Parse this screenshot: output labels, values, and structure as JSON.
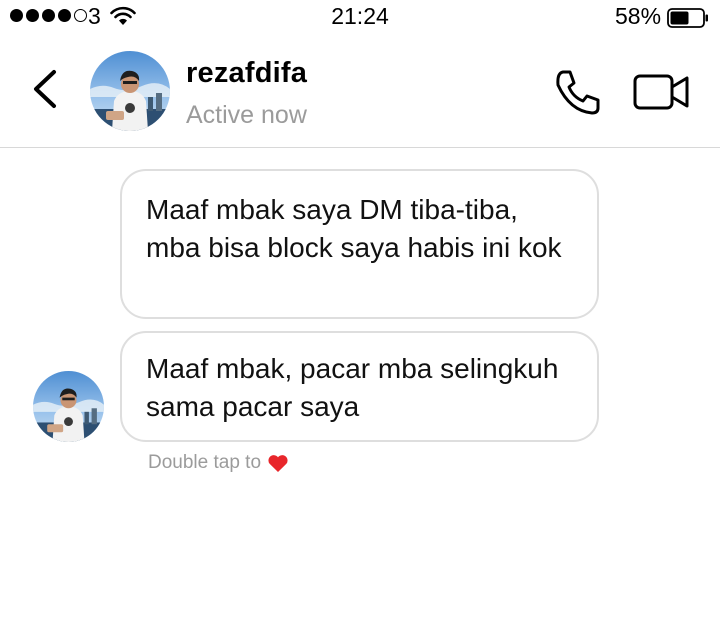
{
  "status_bar": {
    "carrier": "3",
    "time": "21:24",
    "battery_percent": "58%",
    "battery_level": 0.58,
    "signal_bars": 4,
    "signal_max": 5
  },
  "header": {
    "username": "rezafdifa",
    "status": "Active now",
    "icons": [
      "chevron-left-icon",
      "phone-icon",
      "video-camera-icon"
    ]
  },
  "messages": [
    {
      "text": "Maaf mbak saya DM tiba-tiba, mba bisa block saya habis ini kok"
    },
    {
      "text": "Maaf mbak,  pacar mba selingkuh sama pacar saya"
    }
  ],
  "reaction_hint": {
    "text": "Double tap to",
    "icon": "heart-icon",
    "color": "#e8262b"
  }
}
